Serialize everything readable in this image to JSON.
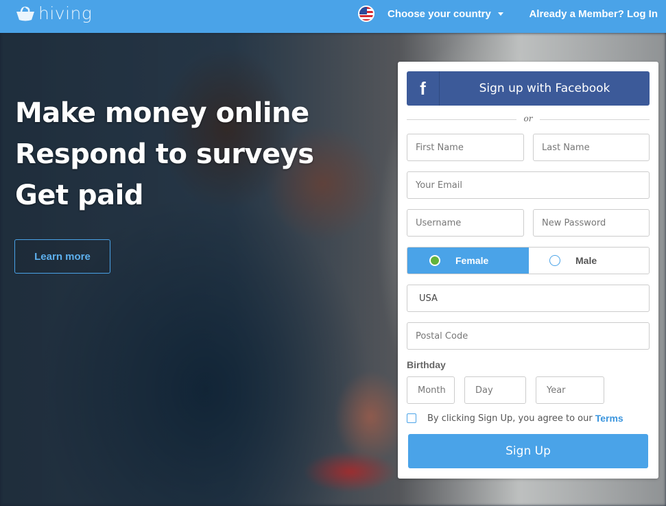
{
  "header": {
    "brand": "hiving",
    "country_label": "Choose your country",
    "login_link": "Already a Member? Log In"
  },
  "hero": {
    "lines": [
      "Make money online",
      "Respond to surveys",
      "Get paid"
    ],
    "learn_more": "Learn more"
  },
  "signup": {
    "facebook_icon": "f",
    "facebook_label": "Sign up with Facebook",
    "or": "or",
    "first_name_placeholder": "First Name",
    "last_name_placeholder": "Last Name",
    "email_placeholder": "Your Email",
    "username_placeholder": "Username",
    "password_placeholder": "New Password",
    "gender": {
      "female": "Female",
      "male": "Male",
      "selected": "Female"
    },
    "country_value": "USA",
    "postal_placeholder": "Postal Code",
    "birthday_label": "Birthday",
    "month_placeholder": "Month",
    "day_placeholder": "Day",
    "year_placeholder": "Year",
    "terms_text": "By clicking Sign Up, you agree to our",
    "terms_link": "Terms",
    "signup_button": "Sign Up"
  },
  "colors": {
    "header_blue": "#4aa3e8",
    "facebook_blue": "#3c5a99",
    "radio_selected_green": "#63b33b"
  },
  "icons": [
    "hiving-logo-icon",
    "us-flag-icon",
    "caret-down-icon",
    "facebook-icon",
    "radio-icon",
    "checkbox-icon"
  ]
}
